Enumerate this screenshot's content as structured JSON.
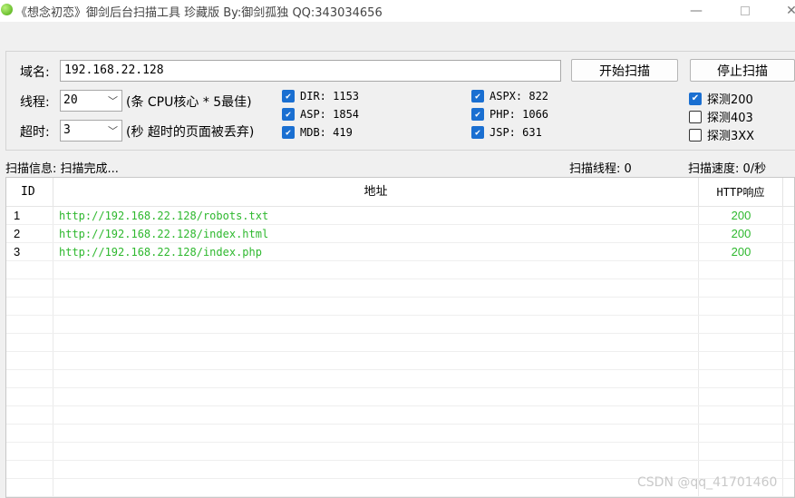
{
  "window": {
    "title": "《想念初恋》御剑后台扫描工具 珍藏版 By:御剑孤独 QQ:343034656",
    "minimize": "—",
    "close": "✕"
  },
  "form": {
    "domain_label": "域名:",
    "domain_value": "192.168.22.128",
    "threads_label": "线程:",
    "threads_value": "20",
    "threads_hint": "(条 CPU核心 * 5最佳)",
    "timeout_label": "超时:",
    "timeout_value": "3",
    "timeout_hint": "(秒 超时的页面被丢弃)",
    "start_button": "开始扫描",
    "stop_button": "停止扫描"
  },
  "dictionaries": [
    {
      "label": "DIR: 1153",
      "checked": true
    },
    {
      "label": "ASP: 1854",
      "checked": true
    },
    {
      "label": "MDB: 419",
      "checked": true
    },
    {
      "label": "ASPX: 822",
      "checked": true
    },
    {
      "label": "PHP: 1066",
      "checked": true
    },
    {
      "label": "JSP: 631",
      "checked": true
    }
  ],
  "probes": [
    {
      "label": "探测200",
      "checked": true
    },
    {
      "label": "探测403",
      "checked": false
    },
    {
      "label": "探测3XX",
      "checked": false
    }
  ],
  "status": {
    "info": "扫描信息: 扫描完成...",
    "threads": "扫描线程: 0",
    "speed": "扫描速度: 0/秒"
  },
  "table": {
    "headers": [
      "ID",
      "地址",
      "HTTP响应"
    ],
    "rows": [
      {
        "id": "1",
        "url": "http://192.168.22.128/robots.txt",
        "code": "200"
      },
      {
        "id": "2",
        "url": "http://192.168.22.128/index.html",
        "code": "200"
      },
      {
        "id": "3",
        "url": "http://192.168.22.128/index.php",
        "code": "200"
      }
    ]
  },
  "colors": {
    "accent": "#1a6fd1",
    "result_text": "#2eb82e"
  },
  "watermark": "CSDN @qq_41701460"
}
